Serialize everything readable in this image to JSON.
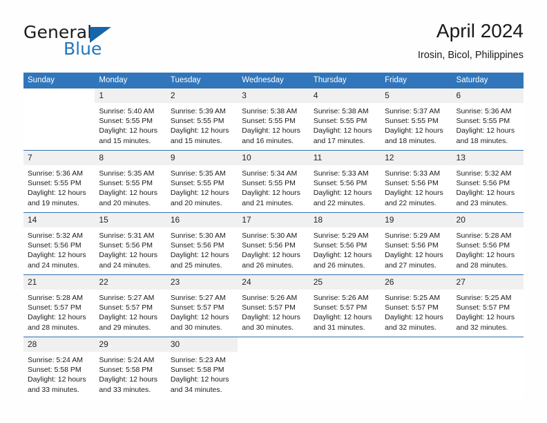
{
  "brand": {
    "name_part1": "General",
    "name_part2": "Blue",
    "logo_icon": "triangle-flag-icon"
  },
  "header": {
    "title": "April 2024",
    "subtitle": "Irosin, Bicol, Philippines"
  },
  "calendar": {
    "weekday_headers": [
      "Sunday",
      "Monday",
      "Tuesday",
      "Wednesday",
      "Thursday",
      "Friday",
      "Saturday"
    ],
    "accent_color": "#3176bb",
    "daynum_band_color": "#f0f0f0",
    "weeks": [
      [
        {
          "day": "",
          "sunrise": "",
          "sunset": "",
          "daylight_line1": "",
          "daylight_line2": ""
        },
        {
          "day": "1",
          "sunrise": "Sunrise: 5:40 AM",
          "sunset": "Sunset: 5:55 PM",
          "daylight_line1": "Daylight: 12 hours",
          "daylight_line2": "and 15 minutes."
        },
        {
          "day": "2",
          "sunrise": "Sunrise: 5:39 AM",
          "sunset": "Sunset: 5:55 PM",
          "daylight_line1": "Daylight: 12 hours",
          "daylight_line2": "and 15 minutes."
        },
        {
          "day": "3",
          "sunrise": "Sunrise: 5:38 AM",
          "sunset": "Sunset: 5:55 PM",
          "daylight_line1": "Daylight: 12 hours",
          "daylight_line2": "and 16 minutes."
        },
        {
          "day": "4",
          "sunrise": "Sunrise: 5:38 AM",
          "sunset": "Sunset: 5:55 PM",
          "daylight_line1": "Daylight: 12 hours",
          "daylight_line2": "and 17 minutes."
        },
        {
          "day": "5",
          "sunrise": "Sunrise: 5:37 AM",
          "sunset": "Sunset: 5:55 PM",
          "daylight_line1": "Daylight: 12 hours",
          "daylight_line2": "and 18 minutes."
        },
        {
          "day": "6",
          "sunrise": "Sunrise: 5:36 AM",
          "sunset": "Sunset: 5:55 PM",
          "daylight_line1": "Daylight: 12 hours",
          "daylight_line2": "and 18 minutes."
        }
      ],
      [
        {
          "day": "7",
          "sunrise": "Sunrise: 5:36 AM",
          "sunset": "Sunset: 5:55 PM",
          "daylight_line1": "Daylight: 12 hours",
          "daylight_line2": "and 19 minutes."
        },
        {
          "day": "8",
          "sunrise": "Sunrise: 5:35 AM",
          "sunset": "Sunset: 5:55 PM",
          "daylight_line1": "Daylight: 12 hours",
          "daylight_line2": "and 20 minutes."
        },
        {
          "day": "9",
          "sunrise": "Sunrise: 5:35 AM",
          "sunset": "Sunset: 5:55 PM",
          "daylight_line1": "Daylight: 12 hours",
          "daylight_line2": "and 20 minutes."
        },
        {
          "day": "10",
          "sunrise": "Sunrise: 5:34 AM",
          "sunset": "Sunset: 5:55 PM",
          "daylight_line1": "Daylight: 12 hours",
          "daylight_line2": "and 21 minutes."
        },
        {
          "day": "11",
          "sunrise": "Sunrise: 5:33 AM",
          "sunset": "Sunset: 5:56 PM",
          "daylight_line1": "Daylight: 12 hours",
          "daylight_line2": "and 22 minutes."
        },
        {
          "day": "12",
          "sunrise": "Sunrise: 5:33 AM",
          "sunset": "Sunset: 5:56 PM",
          "daylight_line1": "Daylight: 12 hours",
          "daylight_line2": "and 22 minutes."
        },
        {
          "day": "13",
          "sunrise": "Sunrise: 5:32 AM",
          "sunset": "Sunset: 5:56 PM",
          "daylight_line1": "Daylight: 12 hours",
          "daylight_line2": "and 23 minutes."
        }
      ],
      [
        {
          "day": "14",
          "sunrise": "Sunrise: 5:32 AM",
          "sunset": "Sunset: 5:56 PM",
          "daylight_line1": "Daylight: 12 hours",
          "daylight_line2": "and 24 minutes."
        },
        {
          "day": "15",
          "sunrise": "Sunrise: 5:31 AM",
          "sunset": "Sunset: 5:56 PM",
          "daylight_line1": "Daylight: 12 hours",
          "daylight_line2": "and 24 minutes."
        },
        {
          "day": "16",
          "sunrise": "Sunrise: 5:30 AM",
          "sunset": "Sunset: 5:56 PM",
          "daylight_line1": "Daylight: 12 hours",
          "daylight_line2": "and 25 minutes."
        },
        {
          "day": "17",
          "sunrise": "Sunrise: 5:30 AM",
          "sunset": "Sunset: 5:56 PM",
          "daylight_line1": "Daylight: 12 hours",
          "daylight_line2": "and 26 minutes."
        },
        {
          "day": "18",
          "sunrise": "Sunrise: 5:29 AM",
          "sunset": "Sunset: 5:56 PM",
          "daylight_line1": "Daylight: 12 hours",
          "daylight_line2": "and 26 minutes."
        },
        {
          "day": "19",
          "sunrise": "Sunrise: 5:29 AM",
          "sunset": "Sunset: 5:56 PM",
          "daylight_line1": "Daylight: 12 hours",
          "daylight_line2": "and 27 minutes."
        },
        {
          "day": "20",
          "sunrise": "Sunrise: 5:28 AM",
          "sunset": "Sunset: 5:56 PM",
          "daylight_line1": "Daylight: 12 hours",
          "daylight_line2": "and 28 minutes."
        }
      ],
      [
        {
          "day": "21",
          "sunrise": "Sunrise: 5:28 AM",
          "sunset": "Sunset: 5:57 PM",
          "daylight_line1": "Daylight: 12 hours",
          "daylight_line2": "and 28 minutes."
        },
        {
          "day": "22",
          "sunrise": "Sunrise: 5:27 AM",
          "sunset": "Sunset: 5:57 PM",
          "daylight_line1": "Daylight: 12 hours",
          "daylight_line2": "and 29 minutes."
        },
        {
          "day": "23",
          "sunrise": "Sunrise: 5:27 AM",
          "sunset": "Sunset: 5:57 PM",
          "daylight_line1": "Daylight: 12 hours",
          "daylight_line2": "and 30 minutes."
        },
        {
          "day": "24",
          "sunrise": "Sunrise: 5:26 AM",
          "sunset": "Sunset: 5:57 PM",
          "daylight_line1": "Daylight: 12 hours",
          "daylight_line2": "and 30 minutes."
        },
        {
          "day": "25",
          "sunrise": "Sunrise: 5:26 AM",
          "sunset": "Sunset: 5:57 PM",
          "daylight_line1": "Daylight: 12 hours",
          "daylight_line2": "and 31 minutes."
        },
        {
          "day": "26",
          "sunrise": "Sunrise: 5:25 AM",
          "sunset": "Sunset: 5:57 PM",
          "daylight_line1": "Daylight: 12 hours",
          "daylight_line2": "and 32 minutes."
        },
        {
          "day": "27",
          "sunrise": "Sunrise: 5:25 AM",
          "sunset": "Sunset: 5:57 PM",
          "daylight_line1": "Daylight: 12 hours",
          "daylight_line2": "and 32 minutes."
        }
      ],
      [
        {
          "day": "28",
          "sunrise": "Sunrise: 5:24 AM",
          "sunset": "Sunset: 5:58 PM",
          "daylight_line1": "Daylight: 12 hours",
          "daylight_line2": "and 33 minutes."
        },
        {
          "day": "29",
          "sunrise": "Sunrise: 5:24 AM",
          "sunset": "Sunset: 5:58 PM",
          "daylight_line1": "Daylight: 12 hours",
          "daylight_line2": "and 33 minutes."
        },
        {
          "day": "30",
          "sunrise": "Sunrise: 5:23 AM",
          "sunset": "Sunset: 5:58 PM",
          "daylight_line1": "Daylight: 12 hours",
          "daylight_line2": "and 34 minutes."
        },
        {
          "day": "",
          "sunrise": "",
          "sunset": "",
          "daylight_line1": "",
          "daylight_line2": ""
        },
        {
          "day": "",
          "sunrise": "",
          "sunset": "",
          "daylight_line1": "",
          "daylight_line2": ""
        },
        {
          "day": "",
          "sunrise": "",
          "sunset": "",
          "daylight_line1": "",
          "daylight_line2": ""
        },
        {
          "day": "",
          "sunrise": "",
          "sunset": "",
          "daylight_line1": "",
          "daylight_line2": ""
        }
      ]
    ]
  }
}
